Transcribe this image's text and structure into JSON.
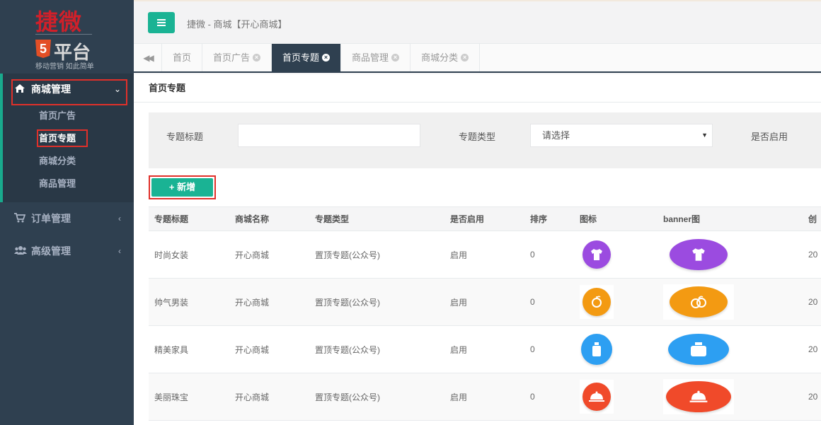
{
  "logo": {
    "name": "捷微",
    "platform": "平台",
    "h5": "5",
    "slogan": "移动营销 如此简单"
  },
  "sidebar": {
    "groups": [
      {
        "label": "商城管理",
        "icon": "home-icon",
        "items": [
          "首页广告",
          "首页专题",
          "商城分类",
          "商品管理"
        ]
      },
      {
        "label": "订单管理",
        "icon": "cart-icon"
      },
      {
        "label": "高级管理",
        "icon": "users-icon"
      }
    ]
  },
  "header": {
    "menu_icon": "hamburger-icon",
    "breadcrumb": "捷微 - 商城【开心商城】"
  },
  "tabs": [
    "首页",
    "首页广告",
    "首页专题",
    "商品管理",
    "商城分类"
  ],
  "panel": {
    "title": "首页专题"
  },
  "filter": {
    "title_label": "专题标题",
    "title_value": "",
    "type_label": "专题类型",
    "type_value": "请选择",
    "enabled_label": "是否启用"
  },
  "add_button": "+ 新增",
  "table": {
    "columns": [
      "专题标题",
      "商城名称",
      "专题类型",
      "是否启用",
      "排序",
      "图标",
      "banner图",
      "创"
    ],
    "rows": [
      {
        "title": "时尚女装",
        "mall": "开心商城",
        "type": "置顶专题(公众号)",
        "enabled": "启用",
        "order": "0",
        "created": "20",
        "icon": "tshirt-icon",
        "color": "#9b4be0"
      },
      {
        "title": "帅气男装",
        "mall": "开心商城",
        "type": "置顶专题(公众号)",
        "enabled": "启用",
        "order": "0",
        "created": "20",
        "icon": "orange-fruit-icon",
        "color": "#f39a12"
      },
      {
        "title": "精美家具",
        "mall": "开心商城",
        "type": "置顶专题(公众号)",
        "enabled": "启用",
        "order": "0",
        "created": "20",
        "icon": "bottle-icon",
        "color": "#2d9ff2"
      },
      {
        "title": "美丽珠宝",
        "mall": "开心商城",
        "type": "置顶专题(公众号)",
        "enabled": "启用",
        "order": "0",
        "created": "20",
        "icon": "cloche-icon",
        "color": "#f04a2a"
      }
    ]
  }
}
